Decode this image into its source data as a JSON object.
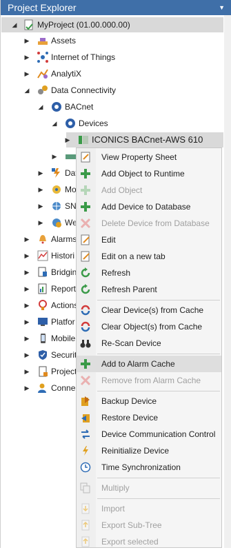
{
  "window": {
    "title": "Project Explorer"
  },
  "tree": {
    "root": "MyProject (01.00.000.00)",
    "assets": "Assets",
    "iot": "Internet of Things",
    "analytix": "AnalytiX",
    "dataconn": "Data Connectivity",
    "bacnet": "BACnet",
    "devices": "Devices",
    "device": "ICONICS BACnet-AWS 610",
    "dat": "Dat",
    "mo": "Mo",
    "sni": "SNI",
    "we": "We",
    "alarms": "Alarms",
    "histori": "Histori",
    "bridgin": "Bridgin",
    "report": "Report",
    "actions": "Actions",
    "platfor": "Platfor",
    "mobile": "Mobile",
    "securit": "Securit",
    "project": "Project",
    "conne": "Conne"
  },
  "menu": {
    "view_property_sheet": "View Property Sheet",
    "add_object_runtime": "Add Object to Runtime",
    "add_object": "Add Object",
    "add_device_db": "Add Device to Database",
    "delete_device_db": "Delete Device from Database",
    "edit": "Edit",
    "edit_new_tab": "Edit on a new tab",
    "refresh": "Refresh",
    "refresh_parent": "Refresh Parent",
    "clear_devices_cache": "Clear Device(s) from Cache",
    "clear_objects_cache": "Clear Object(s) from Cache",
    "rescan": "Re-Scan Device",
    "add_alarm_cache": "Add to Alarm Cache",
    "remove_alarm_cache": "Remove from Alarm Cache",
    "backup": "Backup Device",
    "restore": "Restore Device",
    "dcc": "Device Communication Control",
    "reinit": "Reinitialize Device",
    "timesync": "Time Synchronization",
    "multiply": "Multiply",
    "import": "Import",
    "export_subtree": "Export Sub-Tree",
    "export_selected": "Export selected"
  },
  "colors": {
    "title_bar": "#3f6fa8",
    "green": "#3a9a48",
    "red": "#d23b3b",
    "blue": "#2e6cb5",
    "orange": "#e08a1e"
  }
}
